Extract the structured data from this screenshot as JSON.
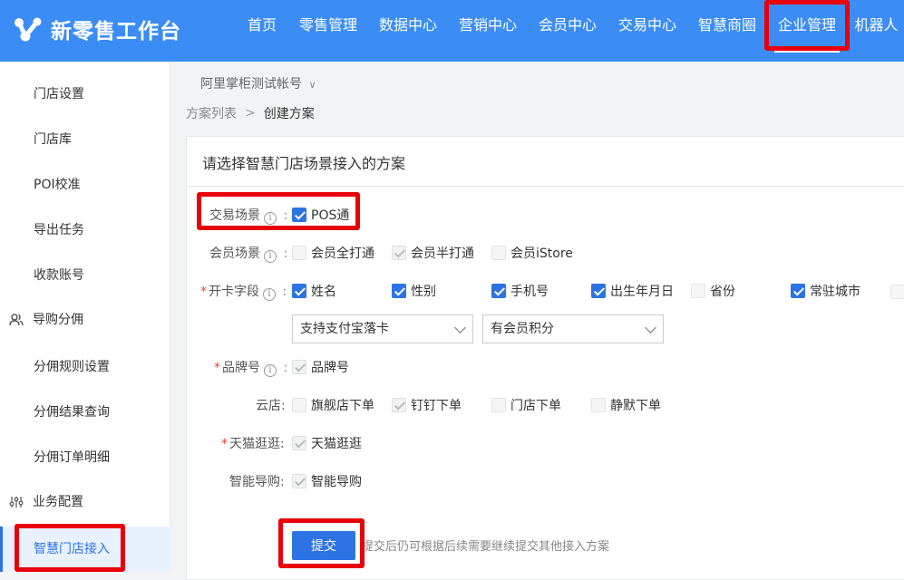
{
  "header": {
    "logo_text": "新零售工作台",
    "nav": [
      "首页",
      "零售管理",
      "数据中心",
      "营销中心",
      "会员中心",
      "交易中心",
      "智慧商圈",
      "企业管理",
      "机器人"
    ],
    "active_nav": "企业管理"
  },
  "sidebar": {
    "items": [
      {
        "label": "门店设置",
        "kind": "sub"
      },
      {
        "label": "门店库",
        "kind": "sub"
      },
      {
        "label": "POI校准",
        "kind": "sub"
      },
      {
        "label": "导出任务",
        "kind": "sub"
      },
      {
        "label": "收款账号",
        "kind": "sub"
      },
      {
        "label": "导购分佣",
        "kind": "group",
        "icon": "people-icon"
      },
      {
        "label": "分佣规则设置",
        "kind": "sub"
      },
      {
        "label": "分佣结果查询",
        "kind": "sub"
      },
      {
        "label": "分佣订单明细",
        "kind": "sub"
      },
      {
        "label": "业务配置",
        "kind": "group",
        "icon": "sliders-icon"
      },
      {
        "label": "智慧门店接入",
        "kind": "sub",
        "active": true
      }
    ]
  },
  "account": {
    "name": "阿里掌柜测试帐号",
    "chevron": "∨"
  },
  "breadcrumb": {
    "parent": "方案列表",
    "sep": ">",
    "current": "创建方案"
  },
  "panel": {
    "title": "请选择智慧门店场景接入的方案",
    "info_glyph": "i",
    "required_mark": "*",
    "trade": {
      "label": "交易场景",
      "options": [
        {
          "label": "POS通",
          "state": "checked"
        }
      ]
    },
    "member": {
      "label": "会员场景",
      "options": [
        {
          "label": "会员全打通",
          "state": "disabled"
        },
        {
          "label": "会员半打通",
          "state": "disabled-checked"
        },
        {
          "label": "会员iStore",
          "state": "disabled"
        }
      ]
    },
    "card_fields": {
      "label": "开卡字段",
      "options": [
        {
          "label": "姓名",
          "state": "checked"
        },
        {
          "label": "性别",
          "state": "checked"
        },
        {
          "label": "手机号",
          "state": "checked"
        },
        {
          "label": "出生年月日",
          "state": "checked"
        },
        {
          "label": "省份",
          "state": "unchecked"
        },
        {
          "label": "常驻城市",
          "state": "checked"
        }
      ]
    },
    "selects": {
      "card_type": "支持支付宝落卡",
      "points": "有会员积分"
    },
    "brand": {
      "label": "品牌号",
      "options": [
        {
          "label": "品牌号",
          "state": "disabled-checked"
        }
      ]
    },
    "cloud_store": {
      "label": "云店:",
      "options": [
        {
          "label": "旗舰店下单",
          "state": "disabled"
        },
        {
          "label": "钉钉下单",
          "state": "disabled-checked"
        },
        {
          "label": "门店下单",
          "state": "disabled"
        },
        {
          "label": "静默下单",
          "state": "disabled"
        }
      ]
    },
    "tmall": {
      "label": "天猫逛逛:",
      "options": [
        {
          "label": "天猫逛逛",
          "state": "disabled-checked"
        }
      ]
    },
    "guide": {
      "label": "智能导购:",
      "options": [
        {
          "label": "智能导购",
          "state": "disabled-checked"
        }
      ]
    },
    "submit_label": "提交",
    "submit_hint": "提交后仍可根据后续需要继续提交其他接入方案"
  },
  "colors": {
    "header_bg": "#3b8df5",
    "accent": "#2d73e5",
    "highlight": "#e8000b",
    "required": "#f04134"
  }
}
